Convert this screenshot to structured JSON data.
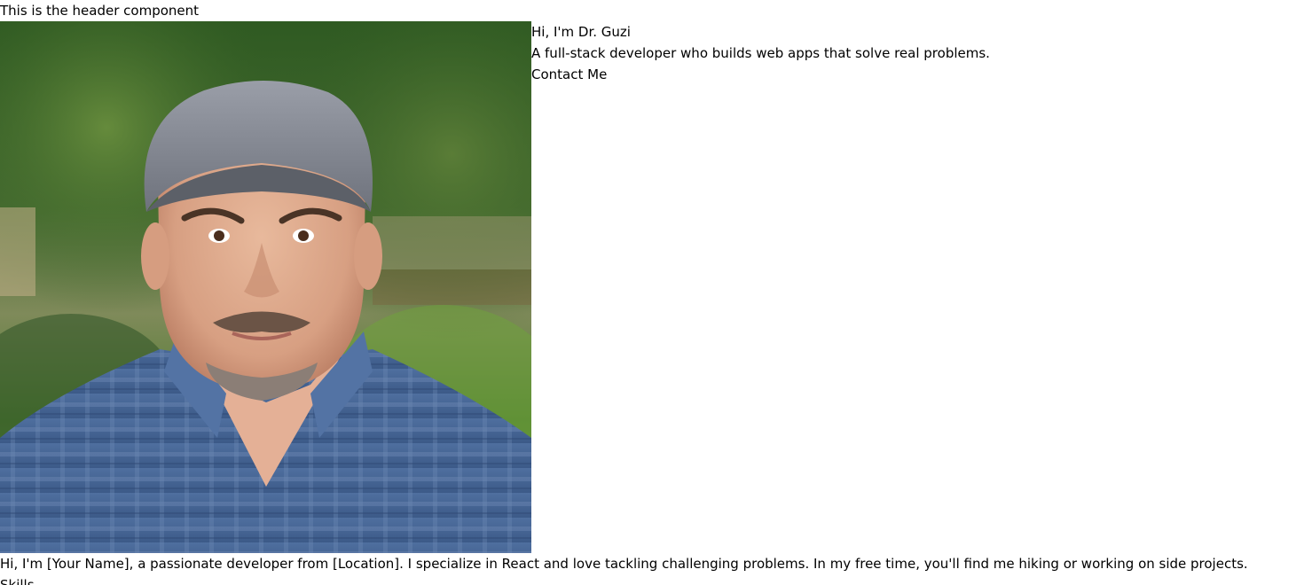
{
  "header": {
    "text": "This is the header component"
  },
  "hero": {
    "greeting": "Hi, I'm Dr. Guzi",
    "tagline": "A full-stack developer who builds web apps that solve real problems.",
    "contact_label": "Contact Me",
    "photo_subject": "portrait-photo"
  },
  "about": {
    "text": "Hi, I'm [Your Name], a passionate developer from [Location]. I specialize in React and love tackling challenging problems. In my free time, you'll find me hiking or working on side projects."
  },
  "skills": {
    "heading": "Skills"
  }
}
